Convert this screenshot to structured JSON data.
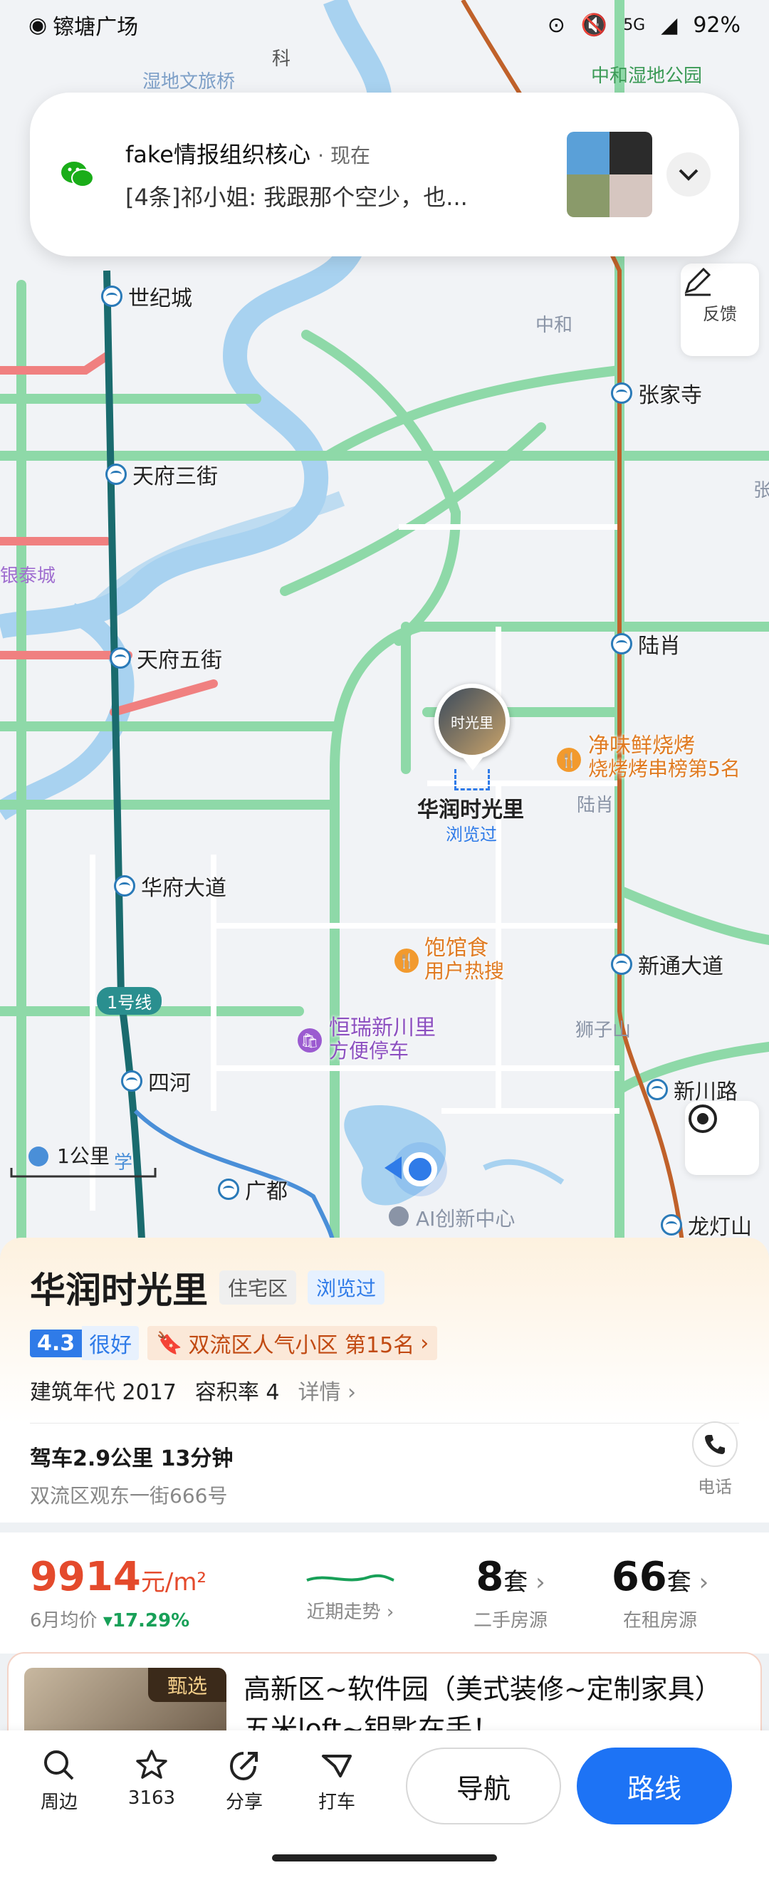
{
  "status_bar": {
    "location": "镲塘广场",
    "battery": "92%",
    "network": "5G"
  },
  "notification": {
    "app": "fake情报组织核心",
    "time": "· 现在",
    "message": "[4条]祁小姐: 我跟那个空少，也..."
  },
  "map": {
    "top_labels": [
      "湿地文旅桥",
      "中和湿地公园",
      "科"
    ],
    "stations": [
      "世纪城",
      "天府三街",
      "天府五街",
      "华府大道",
      "四河",
      "广都",
      "张家寺",
      "陆肖",
      "新通大道",
      "新川路",
      "龙灯山"
    ],
    "district_labels": [
      "中和",
      "银泰城",
      "陆肖",
      "狮子山",
      "张"
    ],
    "line_badge": "1号线",
    "selected_poi": {
      "name": "华润时光里",
      "status": "浏览过",
      "pin_text": "时光里"
    },
    "pois": [
      {
        "name": "净味鲜烧烤",
        "sub": "烧烤烤串榜第5名"
      },
      {
        "name": "饱馆食",
        "sub": "用户热搜"
      },
      {
        "name": "恒瑞新川里",
        "sub": "方便停车"
      },
      {
        "name": "AI创新中心",
        "sub": ""
      }
    ],
    "scale": "1公里",
    "scale_extra": "学",
    "feedback_label": "反馈"
  },
  "place_card": {
    "title": "华润时光里",
    "tags": [
      "住宅区",
      "浏览过"
    ],
    "score": "4.3",
    "score_label": "很好",
    "rank": "双流区人气小区 第15名",
    "build_year": "建筑年代 2017",
    "plot_ratio": "容积率 4",
    "detail": "详情",
    "drive": "驾车2.9公里 13分钟",
    "address": "双流区观东一街666号",
    "phone_label": "电话"
  },
  "price_strip": {
    "price": "9914",
    "price_unit": "元/m²",
    "price_sub_prefix": "6月均价",
    "price_change": "17.29%",
    "trend_label": "近期走势",
    "secondhand_count": "8",
    "secondhand_unit": "套",
    "secondhand_label": "二手房源",
    "rent_count": "66",
    "rent_unit": "套",
    "rent_label": "在租房源"
  },
  "listing": {
    "badge": "甄选",
    "title": "高新区~软件园（美式装修~定制家具）五米loft~钥匙在手！"
  },
  "bottom_bar": {
    "items": [
      "周边",
      "3163",
      "分享",
      "打车"
    ],
    "nav": "导航",
    "route": "路线"
  },
  "colors": {
    "accent": "#1d73f5",
    "price": "#e44a2c",
    "road_green": "#8ed9a8",
    "metro": "#1a6b6e"
  }
}
